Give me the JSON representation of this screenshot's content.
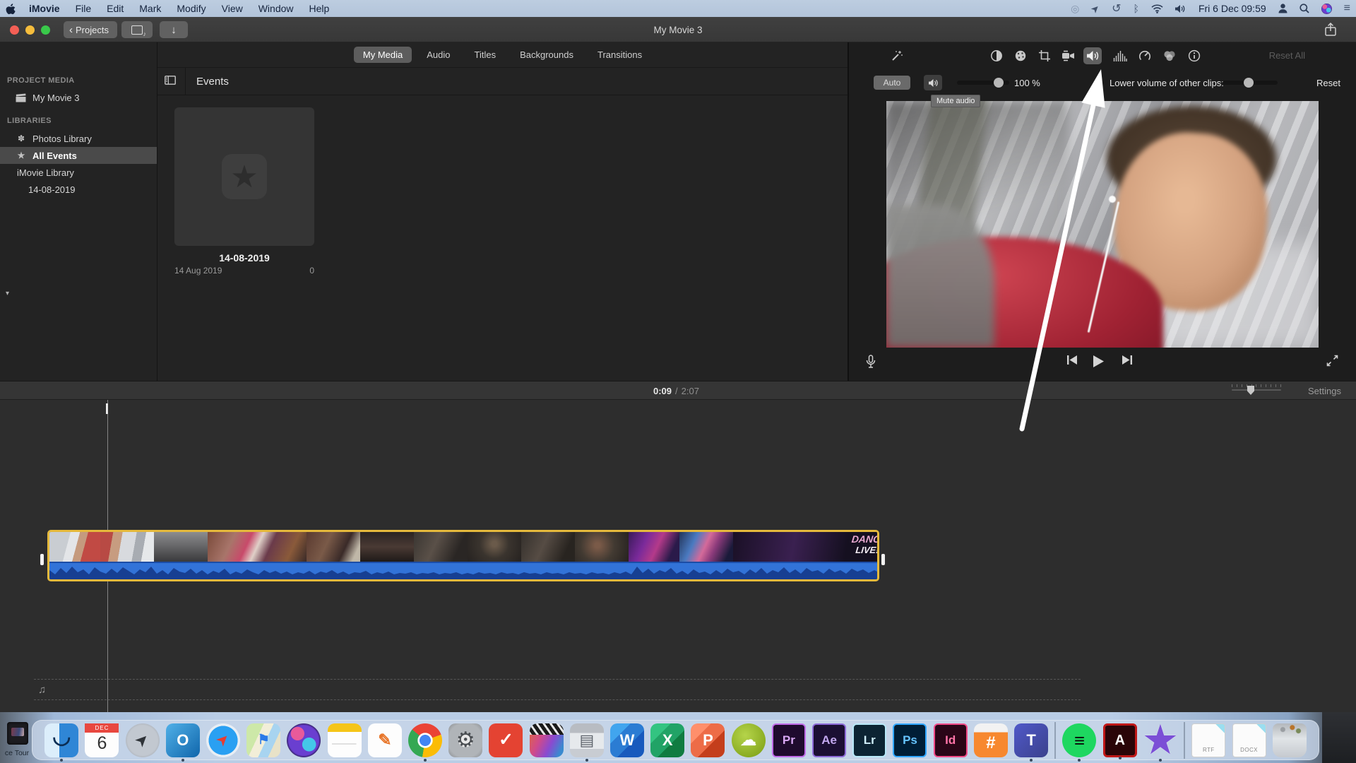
{
  "menu_bar": {
    "items": [
      {
        "label": "iMovie",
        "cls": "strong"
      },
      {
        "label": "File",
        "cls": ""
      },
      {
        "label": "Edit",
        "cls": ""
      },
      {
        "label": "Mark",
        "cls": ""
      },
      {
        "label": "Modify",
        "cls": ""
      },
      {
        "label": "View",
        "cls": ""
      },
      {
        "label": "Window",
        "cls": ""
      },
      {
        "label": "Help",
        "cls": ""
      }
    ],
    "time": "Fri 6 Dec 09:59",
    "status_icons": [
      "spiral-icon",
      "location-icon",
      "time-machine-icon",
      "bluetooth-icon",
      "wifi-icon",
      "volume-icon",
      "user-icon",
      "spotlight-icon",
      "siri-icon",
      "list-icon"
    ]
  },
  "titlebar": {
    "projects_label": "Projects",
    "title": "My Movie 3"
  },
  "tabs": [
    {
      "label": "My Media",
      "cls": "active"
    },
    {
      "label": "Audio",
      "cls": ""
    },
    {
      "label": "Titles",
      "cls": ""
    },
    {
      "label": "Backgrounds",
      "cls": ""
    },
    {
      "label": "Transitions",
      "cls": ""
    }
  ],
  "sidebar": {
    "project_media_header": "PROJECT MEDIA",
    "my_movie": "My Movie 3",
    "libraries_header": "LIBRARIES",
    "photos_library": "Photos Library",
    "all_events": "All Events",
    "imovie_library": "iMovie Library",
    "event_item": "14-08-2019"
  },
  "events": {
    "header": "Events",
    "card_title": "14-08-2019",
    "card_date": "14 Aug 2019",
    "card_count": "0"
  },
  "adjust": {
    "reset_all": "Reset All",
    "icons": [
      "enhance-wand",
      "color-balance",
      "color-correction",
      "crop",
      "stabilization",
      "volume",
      "noise-reduction",
      "speed",
      "clip-filter",
      "clip-info"
    ]
  },
  "volume": {
    "auto_label": "Auto",
    "value": "100 %",
    "lower_label": "Lower volume of other clips:",
    "reset_label": "Reset",
    "tooltip": "Mute audio"
  },
  "timeline": {
    "current_time": "0:09",
    "separator": "/",
    "total_time": "2:07",
    "settings_label": "Settings"
  },
  "clip": {
    "dance_line1": "DANC",
    "dance_line2": "LIVE!"
  },
  "desktop": {
    "icon_label": "ce Tour"
  },
  "dock": [
    {
      "label": "Finder",
      "dname": "dock-finder",
      "cls": "ic-finder running",
      "glyph": "◡",
      "inter": "true"
    },
    {
      "label": "Calendar",
      "dname": "dock-calendar",
      "cls": "ic-cal",
      "glyph": "6",
      "sub": "DEC",
      "inter": "true"
    },
    {
      "label": "Launchpad",
      "dname": "dock-launchpad",
      "cls": "ic-launchpad",
      "glyph": "➤",
      "inter": "true"
    },
    {
      "label": "Outlook",
      "dname": "dock-outlook",
      "cls": "ic-outlook running",
      "glyph": "O",
      "inter": "true"
    },
    {
      "label": "Safari",
      "dname": "dock-safari",
      "cls": "ic-safari",
      "glyph": "➤",
      "inter": "true"
    },
    {
      "label": "Maps",
      "dname": "dock-maps",
      "cls": "ic-maps",
      "glyph": "⚑",
      "inter": "true"
    },
    {
      "label": "Siri",
      "dname": "dock-siri",
      "cls": "ic-siri",
      "inter": "true"
    },
    {
      "label": "Notes",
      "dname": "dock-notes",
      "cls": "ic-notes",
      "inter": "true"
    },
    {
      "label": "Pages",
      "dname": "dock-pages",
      "cls": "ic-pages",
      "glyph": "✎",
      "inter": "true"
    },
    {
      "label": "Chrome",
      "dname": "dock-chrome",
      "cls": "ic-chrome running",
      "inter": "true"
    },
    {
      "label": "System Preferences",
      "dname": "dock-system-preferences",
      "cls": "ic-prefs",
      "glyph": "⚙",
      "inter": "true"
    },
    {
      "label": "Todoist",
      "dname": "dock-todoist",
      "cls": "ic-todoist",
      "glyph": "✓",
      "inter": "true"
    },
    {
      "label": "Final Cut Pro",
      "dname": "dock-final-cut-pro",
      "cls": "ic-fcp",
      "inter": "true"
    },
    {
      "label": "Printer",
      "dname": "dock-printer",
      "cls": "ic-printer running",
      "glyph": "▤",
      "inter": "true"
    },
    {
      "label": "Word",
      "dname": "dock-word",
      "cls": "ic-word",
      "glyph": "W",
      "inter": "true"
    },
    {
      "label": "Excel",
      "dname": "dock-excel",
      "cls": "ic-excel",
      "glyph": "X",
      "inter": "true"
    },
    {
      "label": "PowerPoint",
      "dname": "dock-powerpoint",
      "cls": "ic-ppt",
      "glyph": "P",
      "inter": "true"
    },
    {
      "label": "Cloud App",
      "dname": "dock-cloud-app",
      "cls": "ic-cloud",
      "glyph": "☁",
      "inter": "true"
    },
    {
      "label": "Premiere Pro",
      "dname": "dock-premiere-pro",
      "cls": "adobe ic-pr",
      "glyph": "Pr",
      "inter": "true"
    },
    {
      "label": "After Effects",
      "dname": "dock-after-effects",
      "cls": "adobe ic-ae",
      "glyph": "Ae",
      "inter": "true"
    },
    {
      "label": "Lightroom",
      "dname": "dock-lightroom",
      "cls": "adobe ic-lr",
      "glyph": "Lr",
      "inter": "true"
    },
    {
      "label": "Photoshop",
      "dname": "dock-photoshop",
      "cls": "adobe ic-ps",
      "glyph": "Ps",
      "inter": "true"
    },
    {
      "label": "InDesign",
      "dname": "dock-indesign",
      "cls": "adobe ic-id",
      "glyph": "Id",
      "inter": "true"
    },
    {
      "label": "Calculator",
      "dname": "dock-calculator",
      "cls": "ic-calc",
      "glyph": "#",
      "inter": "true"
    },
    {
      "label": "Teams",
      "dname": "dock-teams",
      "cls": "ic-teams running",
      "glyph": "T",
      "inter": "true"
    },
    {
      "label": "divider",
      "dname": "dock-divider",
      "cls": "dock-divider",
      "inter": "false"
    },
    {
      "label": "Spotify",
      "dname": "dock-spotify",
      "cls": "ic-spotify running",
      "glyph": "≡",
      "inter": "true"
    },
    {
      "label": "Acrobat",
      "dname": "dock-acrobat",
      "cls": "ic-acrobat running",
      "glyph": "A",
      "inter": "true"
    },
    {
      "label": "iMovie",
      "dname": "dock-imovie",
      "cls": "ic-imovie running",
      "glyph": "★",
      "inter": "true"
    },
    {
      "label": "divider",
      "dname": "dock-divider",
      "cls": "dock-divider",
      "inter": "false"
    },
    {
      "label": "RTF file",
      "dname": "dock-file-rtf",
      "cls": "ic-file",
      "sub": "RTF",
      "inter": "true"
    },
    {
      "label": "DOCX file",
      "dname": "dock-file-docx",
      "cls": "ic-file",
      "sub": "DOCX",
      "inter": "true"
    },
    {
      "label": "Trash",
      "dname": "dock-trash",
      "cls": "ic-trash",
      "inter": "true"
    }
  ]
}
